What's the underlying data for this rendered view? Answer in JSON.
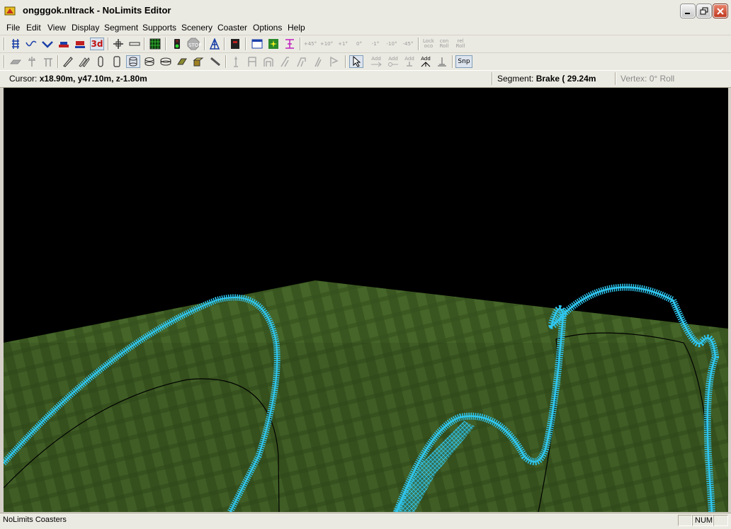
{
  "window": {
    "title": "ongggok.nltrack - NoLimits Editor"
  },
  "menu": [
    "File",
    "Edit",
    "View",
    "Display",
    "Segment",
    "Supports",
    "Scenery",
    "Coaster",
    "Options",
    "Help"
  ],
  "toolbar1": {
    "view3d_label": "3d",
    "stop_label": "STOP",
    "roll_buttons": [
      "+45°",
      "+10°",
      "+1°",
      "0°",
      "-1°",
      "-10°",
      "-45°"
    ],
    "lock_label_top": "Lock",
    "lock_label_bottom": "oco",
    "con_roll_top": "con",
    "con_roll_bottom": "Roll",
    "rel_roll_top": "rel",
    "rel_roll_bottom": "Roll"
  },
  "toolbar2": {
    "add_labels": [
      "Add",
      "Add",
      "Add",
      "Add"
    ],
    "snap_label": "Snp"
  },
  "status": {
    "cursor_label": "Cursor:",
    "cursor_value": "x18.90m, y47.10m, z-1.80m",
    "segment_label": "Segment:",
    "segment_value": "Brake ( 29.24m",
    "vertex_label": "Vertex:",
    "vertex_value": "0° Roll"
  },
  "bottom": {
    "app_name": "NoLimits Coasters",
    "num_indicator": "NUM"
  },
  "colors": {
    "track": "#2ec6ef",
    "ground": "#3e5a22",
    "sky": "#000000"
  }
}
